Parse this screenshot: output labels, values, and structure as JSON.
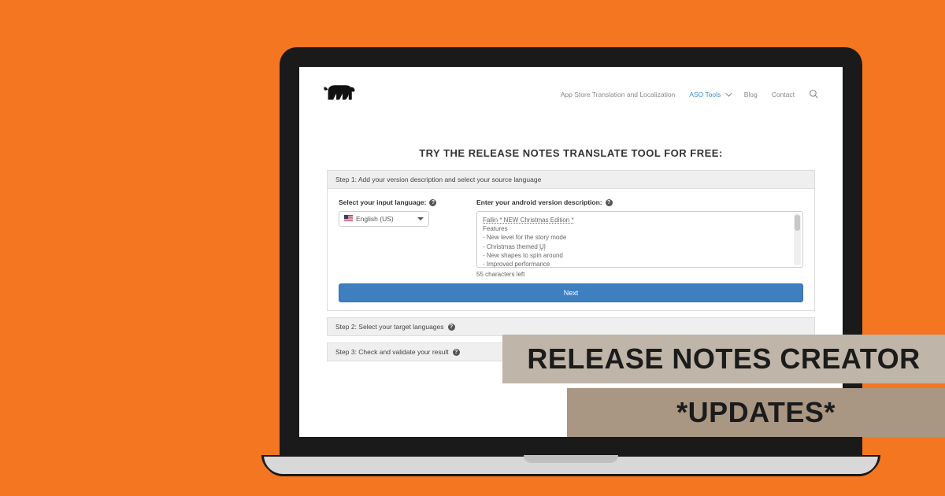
{
  "nav": {
    "items": [
      "App Store Translation and Localization",
      "ASO Tools",
      "Blog",
      "Contact"
    ],
    "active_index": 1
  },
  "hero": {
    "title": "TRY THE RELEASE NOTES TRANSLATE TOOL FOR FREE:"
  },
  "step1": {
    "header": "Step 1: Add your version description and select your source language",
    "input_label": "Select your input language:",
    "desc_label": "Enter your android version description:",
    "selected_lang": "English (US)",
    "textarea_lines": [
      "Fallin * NEW Christmas Edition *",
      "Features",
      "- New level for the story mode",
      "- Christmas themed UI",
      "- New shapes to spin around",
      "- Improved performance"
    ],
    "counter": "55 characters left",
    "next_label": "Next"
  },
  "step2": {
    "header": "Step 2: Select your target languages"
  },
  "step3": {
    "header": "Step 3: Check and validate your result"
  },
  "overlay": {
    "line1": "RELEASE NOTES CREATOR",
    "line2": "*UPDATES*"
  }
}
